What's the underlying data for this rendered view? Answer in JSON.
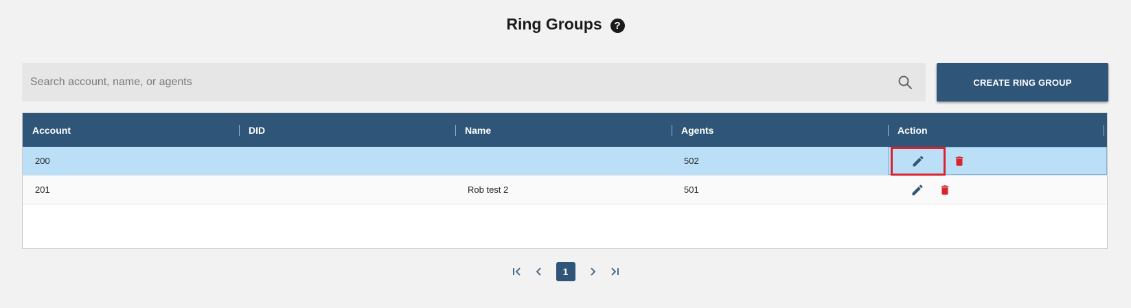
{
  "page": {
    "title": "Ring Groups",
    "help_glyph": "?"
  },
  "search": {
    "placeholder": "Search account, name, or agents",
    "value": ""
  },
  "toolbar": {
    "create_label": "CREATE RING GROUP"
  },
  "table": {
    "columns": [
      "Account",
      "DID",
      "Name",
      "Agents",
      "Action"
    ],
    "rows": [
      {
        "account": "200",
        "did": "",
        "name": "",
        "agents": "502",
        "selected": true
      },
      {
        "account": "201",
        "did": "",
        "name": "Rob test 2",
        "agents": "501",
        "selected": false
      }
    ]
  },
  "pagination": {
    "current_page": "1"
  },
  "colors": {
    "accent": "#2f5578",
    "selected_row": "#bcdff8",
    "delete": "#d9232d",
    "highlight_box": "#d9232d"
  },
  "icons": [
    "help-icon",
    "search-icon",
    "edit-icon",
    "trash-icon",
    "first-page-icon",
    "prev-page-icon",
    "next-page-icon",
    "last-page-icon"
  ]
}
